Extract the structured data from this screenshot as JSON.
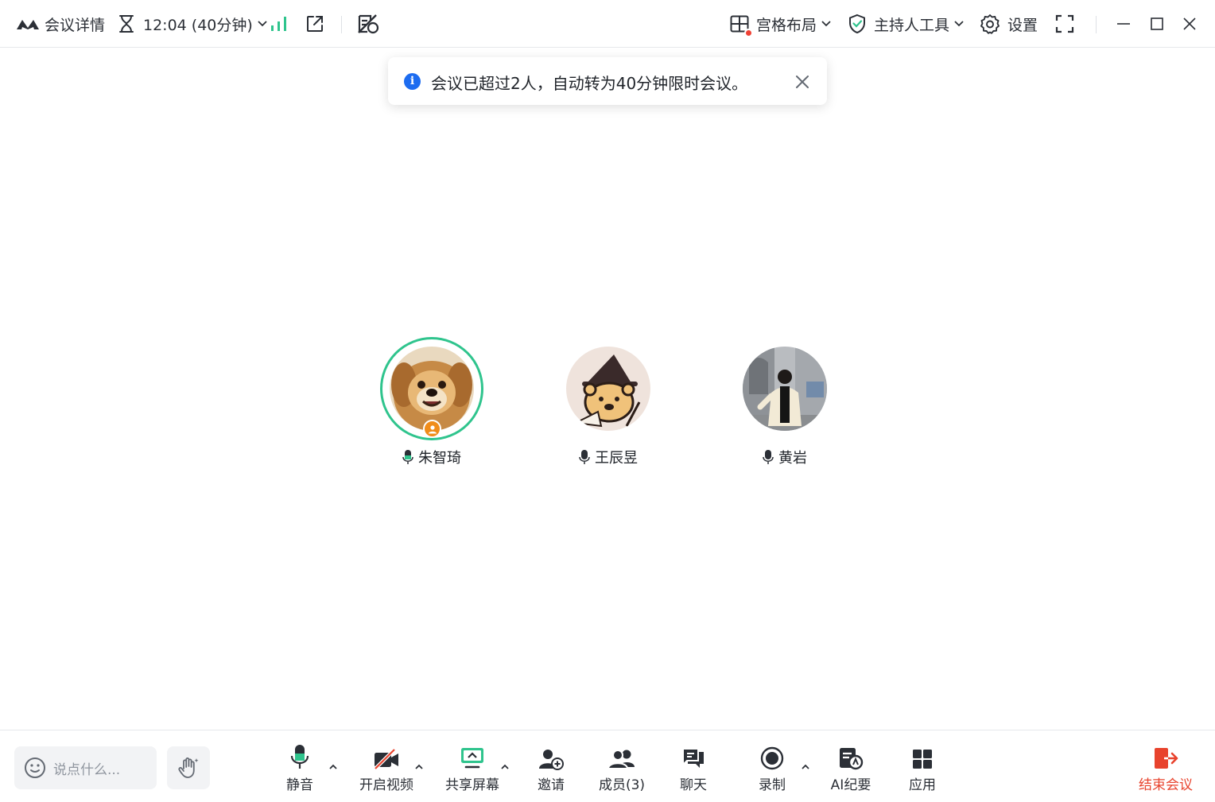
{
  "titlebar": {
    "meeting_details": "会议详情",
    "timer": "12:04 (40分钟)",
    "layout": "宫格布局",
    "host_tools": "主持人工具",
    "settings": "设置"
  },
  "toast": {
    "message": "会议已超过2人，自动转为40分钟限时会议。"
  },
  "participants": [
    {
      "name": "朱智琦",
      "is_host": true,
      "speaking": true
    },
    {
      "name": "王辰昱",
      "is_host": false,
      "speaking": false
    },
    {
      "name": "黄岩",
      "is_host": false,
      "speaking": false
    }
  ],
  "bottombar": {
    "chat_placeholder": "说点什么...",
    "mute": "静音",
    "start_video": "开启视频",
    "share_screen": "共享屏幕",
    "invite": "邀请",
    "members": "成员(3)",
    "chat": "聊天",
    "record": "录制",
    "ai_minutes": "AI纪要",
    "apps": "应用",
    "end_meeting": "结束会议"
  },
  "colors": {
    "accent_green": "#2fc48d",
    "signal_green": "#2fc48d",
    "info_blue": "#1d6cf0",
    "end_red": "#e8432d",
    "host_orange": "#f08c1a",
    "icon_dark": "#2b2f36"
  }
}
